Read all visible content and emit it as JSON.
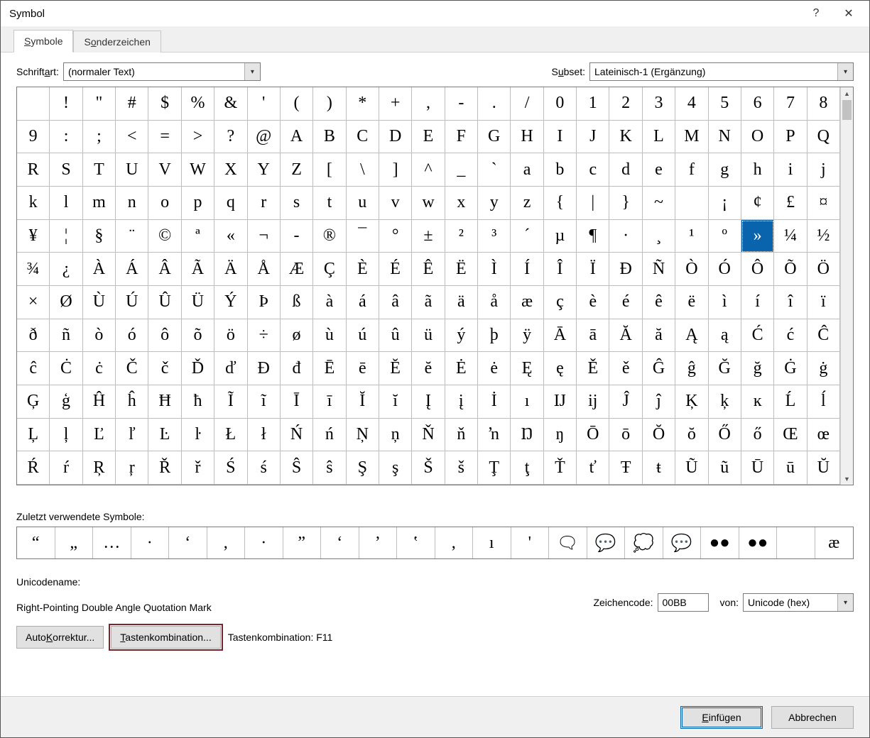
{
  "window": {
    "title": "Symbol"
  },
  "tabs": [
    {
      "label_pre": "",
      "u": "S",
      "label_post": "ymbole"
    },
    {
      "label_pre": "S",
      "u": "o",
      "label_post": "nderzeichen"
    }
  ],
  "font": {
    "label_pre": "Schrift",
    "label_u": "a",
    "label_post": "rt:",
    "value": "(normaler Text)"
  },
  "subset": {
    "label_pre": "S",
    "label_u": "u",
    "label_post": "bset:",
    "value": "Lateinisch-1 (Ergänzung)"
  },
  "grid": {
    "rows": [
      [
        " ",
        "!",
        "\"",
        "#",
        "$",
        "%",
        "&",
        "'",
        "(",
        ")",
        "*",
        "+",
        ",",
        "-",
        ".",
        "/",
        "0",
        "1",
        "2",
        "3",
        "4",
        "5",
        "6",
        "7",
        "8"
      ],
      [
        "9",
        ":",
        ";",
        "<",
        "=",
        ">",
        "?",
        "@",
        "A",
        "B",
        "C",
        "D",
        "E",
        "F",
        "G",
        "H",
        "I",
        "J",
        "K",
        "L",
        "M",
        "N",
        "O",
        "P",
        "Q"
      ],
      [
        "R",
        "S",
        "T",
        "U",
        "V",
        "W",
        "X",
        "Y",
        "Z",
        "[",
        "\\",
        "]",
        "^",
        "_",
        "`",
        "a",
        "b",
        "c",
        "d",
        "e",
        "f",
        "g",
        "h",
        "i",
        "j"
      ],
      [
        "k",
        "l",
        "m",
        "n",
        "o",
        "p",
        "q",
        "r",
        "s",
        "t",
        "u",
        "v",
        "w",
        "x",
        "y",
        "z",
        "{",
        "|",
        "}",
        "~",
        " ",
        "¡",
        "¢",
        "£",
        "¤"
      ],
      [
        "¥",
        "¦",
        "§",
        "¨",
        "©",
        "ª",
        "«",
        "¬",
        "-",
        "®",
        "¯",
        "°",
        "±",
        "²",
        "³",
        "´",
        "µ",
        "¶",
        "·",
        "¸",
        "¹",
        "º",
        "»",
        "¼",
        "½"
      ],
      [
        "¾",
        "¿",
        "À",
        "Á",
        "Â",
        "Ã",
        "Ä",
        "Å",
        "Æ",
        "Ç",
        "È",
        "É",
        "Ê",
        "Ë",
        "Ì",
        "Í",
        "Î",
        "Ï",
        "Đ",
        "Ñ",
        "Ò",
        "Ó",
        "Ô",
        "Õ",
        "Ö"
      ],
      [
        "×",
        "Ø",
        "Ù",
        "Ú",
        "Û",
        "Ü",
        "Ý",
        "Þ",
        "ß",
        "à",
        "á",
        "â",
        "ã",
        "ä",
        "å",
        "æ",
        "ç",
        "è",
        "é",
        "ê",
        "ë",
        "ì",
        "í",
        "î",
        "ï"
      ],
      [
        "ð",
        "ñ",
        "ò",
        "ó",
        "ô",
        "õ",
        "ö",
        "÷",
        "ø",
        "ù",
        "ú",
        "û",
        "ü",
        "ý",
        "þ",
        "ÿ",
        "Ā",
        "ā",
        "Ă",
        "ă",
        "Ą",
        "ą",
        "Ć",
        "ć",
        "Ĉ"
      ],
      [
        "ĉ",
        "Ċ",
        "ċ",
        "Č",
        "č",
        "Ď",
        "ď",
        "Đ",
        "đ",
        "Ē",
        "ē",
        "Ĕ",
        "ĕ",
        "Ė",
        "ė",
        "Ę",
        "ę",
        "Ě",
        "ě",
        "Ĝ",
        "ĝ",
        "Ğ",
        "ğ",
        "Ġ",
        "ġ"
      ],
      [
        "Ģ",
        "ģ",
        "Ĥ",
        "ĥ",
        "Ħ",
        "ħ",
        "Ĩ",
        "ĩ",
        "Ī",
        "ī",
        "Ĭ",
        "ĭ",
        "Į",
        "į",
        "İ",
        "ı",
        "Ĳ",
        "ĳ",
        "Ĵ",
        "ĵ",
        "Ķ",
        "ķ",
        "ĸ",
        "Ĺ",
        "ĺ"
      ],
      [
        "Ļ",
        "ļ",
        "Ľ",
        "ľ",
        "Ŀ",
        "ŀ",
        "Ł",
        "ł",
        "Ń",
        "ń",
        "Ņ",
        "ņ",
        "Ň",
        "ň",
        "ŉ",
        "Ŋ",
        "ŋ",
        "Ō",
        "ō",
        "Ŏ",
        "ŏ",
        "Ő",
        "ő",
        "Œ",
        "œ"
      ],
      [
        "Ŕ",
        "ŕ",
        "Ŗ",
        "ŗ",
        "Ř",
        "ř",
        "Ś",
        "ś",
        "Ŝ",
        "ŝ",
        "Ş",
        "ş",
        "Š",
        "š",
        "Ţ",
        "ţ",
        "Ť",
        "ť",
        "Ŧ",
        "ŧ",
        "Ũ",
        "ũ",
        "Ū",
        "ū",
        "Ŭ"
      ]
    ],
    "selected": [
      4,
      22
    ]
  },
  "recent": {
    "label_pre": "",
    "label_u": "Z",
    "label_post": "uletzt verwendete Symbole:",
    "items": [
      "“",
      "„",
      "…",
      "·",
      "‘",
      ",",
      "·",
      "”",
      "‘",
      "’",
      "‛",
      ",",
      "ı",
      "'",
      "🗨",
      "💬",
      "💭",
      "💬",
      "●●",
      "●●",
      " ",
      "æ"
    ]
  },
  "unicode": {
    "name_label": "Unicodename:",
    "name_value": "Right-Pointing Double Angle Quotation Mark",
    "code_label_pre": "Zeichen",
    "code_label_u": "c",
    "code_label_post": "ode:",
    "code_value": "00BB",
    "from_label_pre": "vo",
    "from_label_u": "n",
    "from_label_post": ":",
    "from_value": "Unicode (hex)"
  },
  "buttons": {
    "autocorrect_pre": "Auto",
    "autocorrect_u": "K",
    "autocorrect_post": "orrektur...",
    "shortcut_pre": "",
    "shortcut_u": "T",
    "shortcut_post": "astenkombination...",
    "shortcut_info_label": "Tastenkombination:",
    "shortcut_info_value": "F11",
    "insert_pre": "",
    "insert_u": "E",
    "insert_post": "infügen",
    "cancel": "Abbrechen"
  }
}
